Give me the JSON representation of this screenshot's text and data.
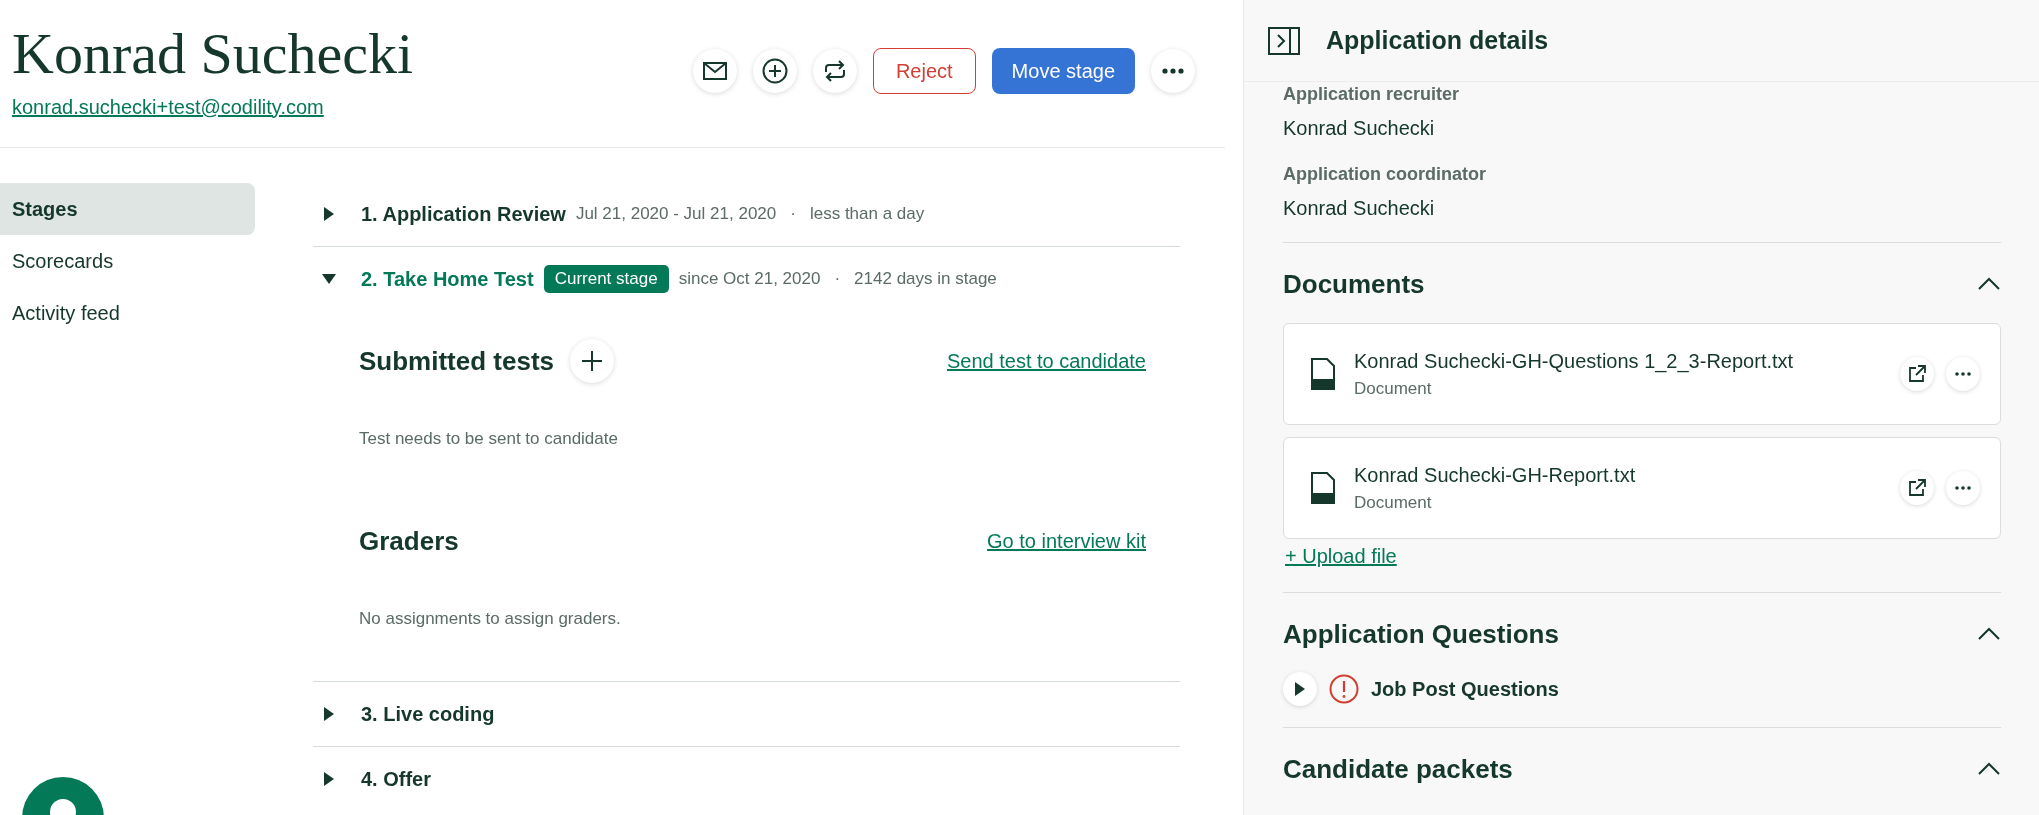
{
  "candidate": {
    "name": "Konrad Suchecki",
    "email": "konrad.suchecki+test@codility.com"
  },
  "actions": [
    {
      "kind": "mail"
    },
    {
      "kind": "add"
    },
    {
      "kind": "transfer"
    },
    {
      "kind": "reject",
      "label": "Reject"
    },
    {
      "kind": "move",
      "label": "Move stage"
    },
    {
      "kind": "more"
    }
  ],
  "nav": [
    {
      "label": "Stages",
      "selected": true
    },
    {
      "label": "Scorecards",
      "selected": false
    },
    {
      "label": "Activity feed",
      "selected": false
    }
  ],
  "stages": [
    {
      "title": "1. Application Review",
      "expanded": false,
      "dates": "Jul 21, 2020 - Jul 21, 2020",
      "separator": "·",
      "duration": "less than a day"
    },
    {
      "title": "2. Take Home Test",
      "expanded": true,
      "badge": "Current stage",
      "dates": "since Oct 21, 2020",
      "separator": "·",
      "duration": "2142 days in stage",
      "sections": [
        {
          "title": "Submitted tests",
          "add_button": true,
          "link": "Send test to candidate",
          "note": "Test needs to be sent to candidate"
        },
        {
          "title": "Graders",
          "add_button": false,
          "link": "Go to interview kit",
          "note": "No assignments to assign graders."
        }
      ]
    },
    {
      "title": "3. Live coding",
      "expanded": false
    },
    {
      "title": "4. Offer",
      "expanded": false
    }
  ],
  "details": {
    "title": "Application details",
    "fields": [
      {
        "label": "Application recruiter",
        "value": "Konrad Suchecki"
      },
      {
        "label": "Application coordinator",
        "value": "Konrad Suchecki"
      }
    ],
    "documents": {
      "title": "Documents",
      "expanded": true,
      "files": [
        {
          "name": "Konrad Suchecki-GH-Questions 1_2_3-Report.txt",
          "type": "Document"
        },
        {
          "name": "Konrad Suchecki-GH-Report.txt",
          "type": "Document"
        }
      ],
      "upload": "+ Upload file"
    },
    "questions": {
      "title": "Application Questions",
      "expanded": true,
      "items": [
        {
          "label": "Job Post Questions",
          "expanded": false,
          "warning": true
        }
      ]
    },
    "packets": {
      "title": "Candidate packets",
      "expanded": true
    }
  }
}
